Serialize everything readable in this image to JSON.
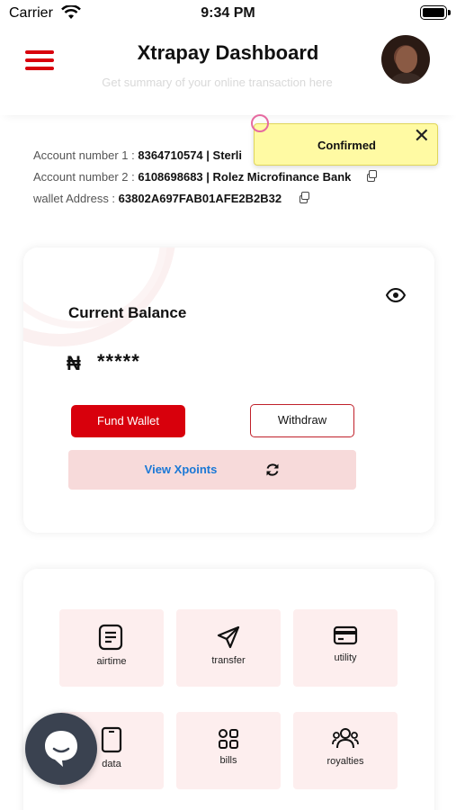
{
  "status_bar": {
    "carrier": "Carrier",
    "time": "9:34 PM"
  },
  "header": {
    "title": "Xtrapay Dashboard",
    "subtitle": "Get summary of your online transaction here"
  },
  "accounts": {
    "acct1_label": "Account number 1 :",
    "acct1_value": "8364710574 | Sterli",
    "acct2_label": "Account number 2 :",
    "acct2_value": "6108698683 | Rolez Microfinance Bank",
    "wallet_label": "wallet Address :",
    "wallet_value": "63802A697FAB01AFE2B2B32"
  },
  "toast": {
    "message": "Confirmed",
    "close": "✕"
  },
  "balance": {
    "label": "Current Balance",
    "currency_symbol": "₦",
    "masked_value": "*****",
    "fund_wallet": "Fund Wallet",
    "withdraw": "Withdraw",
    "xpoints": "View Xpoints"
  },
  "services": [
    {
      "label": "airtime",
      "icon": "document-icon"
    },
    {
      "label": "transfer",
      "icon": "send-icon"
    },
    {
      "label": "utility",
      "icon": "card-icon"
    },
    {
      "label": "data",
      "icon": "phone-icon"
    },
    {
      "label": "bills",
      "icon": "grid-icon"
    },
    {
      "label": "royalties",
      "icon": "users-icon"
    }
  ],
  "colors": {
    "brand_red": "#d8000c",
    "link_blue": "#1a78d6",
    "toast_yellow": "#fffaa3",
    "tile_pink": "#fdeeee"
  }
}
